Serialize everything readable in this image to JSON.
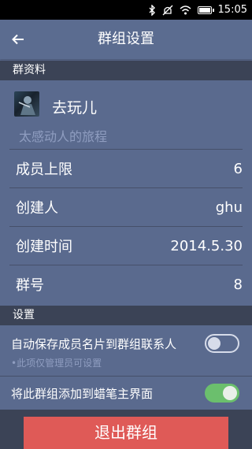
{
  "status_bar": {
    "time": "15:05"
  },
  "header": {
    "title": "群组设置"
  },
  "section_group": "群资料",
  "group": {
    "name": "去玩儿",
    "description": "太感动人的旅程"
  },
  "info_rows": [
    {
      "label": "成员上限",
      "value": "6"
    },
    {
      "label": "创建人",
      "value": "ghu"
    },
    {
      "label": "创建时间",
      "value": "2014.5.30"
    },
    {
      "label": "群号",
      "value": "8"
    }
  ],
  "section_settings": "设置",
  "settings": {
    "auto_save": {
      "label": "自动保存成员名片到群组联系人",
      "hint": "•此项仅管理员可设置",
      "on": false
    },
    "add_to_main": {
      "label": "将此群组添加到蜡笔主界面",
      "on": true
    }
  },
  "exit_button": "退出群组",
  "colors": {
    "background": "#5a6a8e",
    "section": "#3b4356",
    "toggle_on": "#6bbf6d",
    "exit": "#df5a57"
  }
}
